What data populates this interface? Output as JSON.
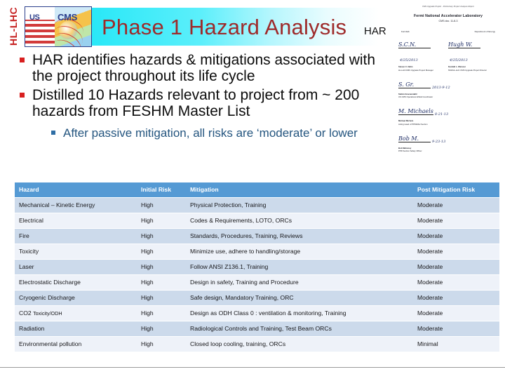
{
  "slide": {
    "title": "Phase 1 Hazard Analysis",
    "har_label": "HAR"
  },
  "logo": {
    "program": "HL-LHC",
    "us": "US",
    "cms": "CMS"
  },
  "bullets": [
    {
      "level": 1,
      "text": "HAR identifies hazards & mitigations associated with the project throughout its life cycle"
    },
    {
      "level": 1,
      "text": "Distilled 10 Hazards relevant to project from ~ 200 hazards from FESHM Master List"
    },
    {
      "level": 3,
      "text": "After passive mitigation, all risks are ‘moderate’ or lower"
    }
  ],
  "har_document": {
    "header_note": "CMS Upgrade Project - Preliminary Project Analysis Report",
    "organization": "Fermi National Accelerator Laboratory",
    "doc_number": "CMS doc. 11-8-3",
    "left_col": "Fermilab",
    "right_col": "Department of Energy",
    "signatures": [
      {
        "script": "S.C.N.",
        "date": "4/25/2013",
        "name": "Steven C. Nahn",
        "date_label": "Date",
        "role": "HL-LHC/CMS Upgrade Project Manager"
      },
      {
        "script": "Hugh W.",
        "date": "4/25/2013",
        "name": "Kendall L. Weisner",
        "date_label": "Date",
        "role": "NSF/HL-LHC CMS Upgrade Project Director"
      },
      {
        "script": "S. Gr.",
        "date": "2013-9-12",
        "name": "Stefan Gruenendahl",
        "date_label": "Date",
        "role": "US CMS Operations ES&H Coordinator"
      },
      {
        "script": "M. Michaels",
        "date": "8-21-13",
        "name": "Michael Michels",
        "date_label": "Date",
        "role": "Acting Head of PPD/ESH Section"
      },
      {
        "script": "Bob M.",
        "date": "9-23-13",
        "name": "Bob Mahoney",
        "date_label": "Date",
        "role": "PPD Section Safety Officer"
      }
    ]
  },
  "table": {
    "headers": [
      "Hazard",
      "Initial Risk",
      "Mitigation",
      "Post Mitigation Risk"
    ],
    "rows": [
      {
        "hazard": "Mechanical – Kinetic Energy",
        "hazard_sub": "",
        "initial": "High",
        "mitigation": "Physical Protection, Training",
        "post": "Moderate"
      },
      {
        "hazard": "Electrical",
        "hazard_sub": "",
        "initial": "High",
        "mitigation": "Codes & Requirements, LOTO, ORCs",
        "post": "Moderate"
      },
      {
        "hazard": "Fire",
        "hazard_sub": "",
        "initial": "High",
        "mitigation": "Standards, Procedures, Training, Reviews",
        "post": "Moderate"
      },
      {
        "hazard": "Toxicity",
        "hazard_sub": "",
        "initial": "High",
        "mitigation": "Minimize use, adhere to handling/storage",
        "post": "Moderate"
      },
      {
        "hazard": "Laser",
        "hazard_sub": "",
        "initial": "High",
        "mitigation": "Follow ANSI Z136.1, Training",
        "post": "Moderate"
      },
      {
        "hazard": "Electrostatic Discharge",
        "hazard_sub": "",
        "initial": "High",
        "mitigation": "Design in safety, Training and Procedure",
        "post": "Moderate"
      },
      {
        "hazard": "Cryogenic  Discharge",
        "hazard_sub": "",
        "initial": "High",
        "mitigation": "Safe design,  Mandatory Training, ORC",
        "post": "Moderate"
      },
      {
        "hazard": "CO2 ",
        "hazard_sub": "Toxicity/ODH",
        "initial": "High",
        "mitigation": "Design as ODH Class 0 : ventilation & monitoring, Training",
        "post": "Moderate"
      },
      {
        "hazard": "Radiation",
        "hazard_sub": "",
        "initial": "High",
        "mitigation": "Radiological Controls and Training, Test Beam ORCs",
        "post": "Moderate"
      },
      {
        "hazard": "Environmental pollution",
        "hazard_sub": "",
        "initial": "High",
        "mitigation": "Closed loop cooling, training, ORCs",
        "post": "Minimal"
      }
    ]
  },
  "colors": {
    "title_text": "#9e2a2a",
    "band_start": "#29e8f7",
    "bullet_red": "#d81f1f",
    "bullet_blue": "#2f6ea5",
    "sub_bullet_text": "#24557f",
    "table_header_bg": "#559ad4",
    "row_dark": "#ccdaeb",
    "row_light": "#eef2f9"
  }
}
